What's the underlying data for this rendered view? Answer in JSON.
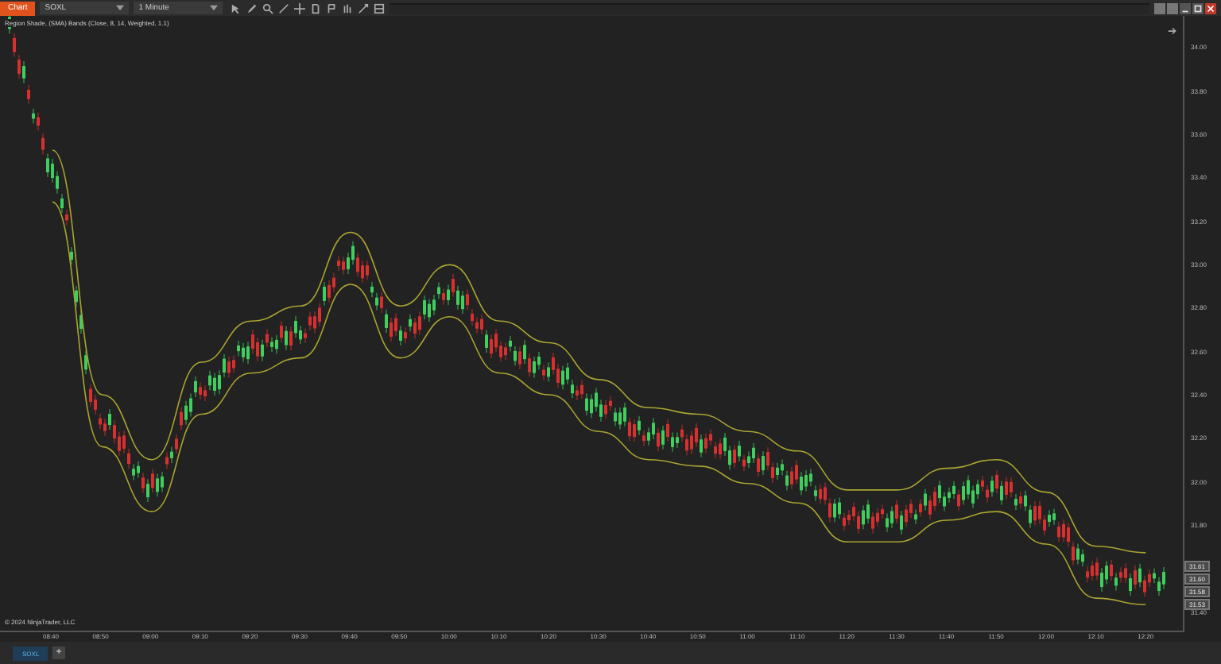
{
  "toolbar": {
    "chart_button": "Chart",
    "instrument": "SOXL",
    "interval": "1 Minute"
  },
  "indicator_label": "Region Shade, (SMA) Bands (Close, 8, 14, Weighted, 1.1)",
  "copyright": "© 2024 NinjaTrader, LLC",
  "chart_data": {
    "type": "line",
    "categories": [
      "08:40",
      "08:50",
      "09:00",
      "09:10",
      "09:20",
      "09:30",
      "09:40",
      "09:50",
      "10:00",
      "10:10",
      "10:20",
      "10:30",
      "10:40",
      "10:50",
      "11:00",
      "11:10",
      "11:20",
      "11:30",
      "11:40",
      "11:50",
      "12:00",
      "12:10",
      "12:20"
    ],
    "series": [
      {
        "color": "#a9a431",
        "values": [
          33.53,
          32.4,
          32.1,
          32.55,
          32.74,
          32.81,
          33.15,
          32.81,
          33.0,
          32.74,
          32.64,
          32.47,
          32.34,
          32.31,
          32.23,
          32.14,
          31.96,
          31.96,
          32.06,
          32.1,
          31.95,
          31.7,
          31.67
        ]
      },
      {
        "color": "#a9a431",
        "values": [
          33.29,
          32.16,
          31.86,
          32.31,
          32.5,
          32.57,
          32.91,
          32.57,
          32.76,
          32.5,
          32.4,
          32.23,
          32.1,
          32.07,
          31.99,
          31.9,
          31.72,
          31.72,
          31.82,
          31.86,
          31.71,
          31.46,
          31.43
        ]
      }
    ],
    "ylim": [
      31.31,
      34.15
    ],
    "yticks": [
      {
        "value": 34.0,
        "label": "34.00"
      },
      {
        "value": 33.8,
        "label": "33.80"
      },
      {
        "value": 33.6,
        "label": "33.60"
      },
      {
        "value": 33.4,
        "label": "33.40"
      },
      {
        "value": 33.2,
        "label": "33.20"
      },
      {
        "value": 33.0,
        "label": "33.00"
      },
      {
        "value": 32.8,
        "label": "32.80"
      },
      {
        "value": 32.6,
        "label": "32.60"
      },
      {
        "value": 32.4,
        "label": "32.40"
      },
      {
        "value": 32.2,
        "label": "32.20"
      },
      {
        "value": 32.0,
        "label": "32.00"
      },
      {
        "value": 31.8,
        "label": "31.80"
      },
      {
        "value": 31.4,
        "label": "31.40"
      }
    ]
  },
  "price_badges": [
    "31.61",
    "31.60",
    "31.58",
    "31.53"
  ],
  "tabs": [
    {
      "label": "SOXL",
      "selected": true
    }
  ],
  "add_tab": "+"
}
